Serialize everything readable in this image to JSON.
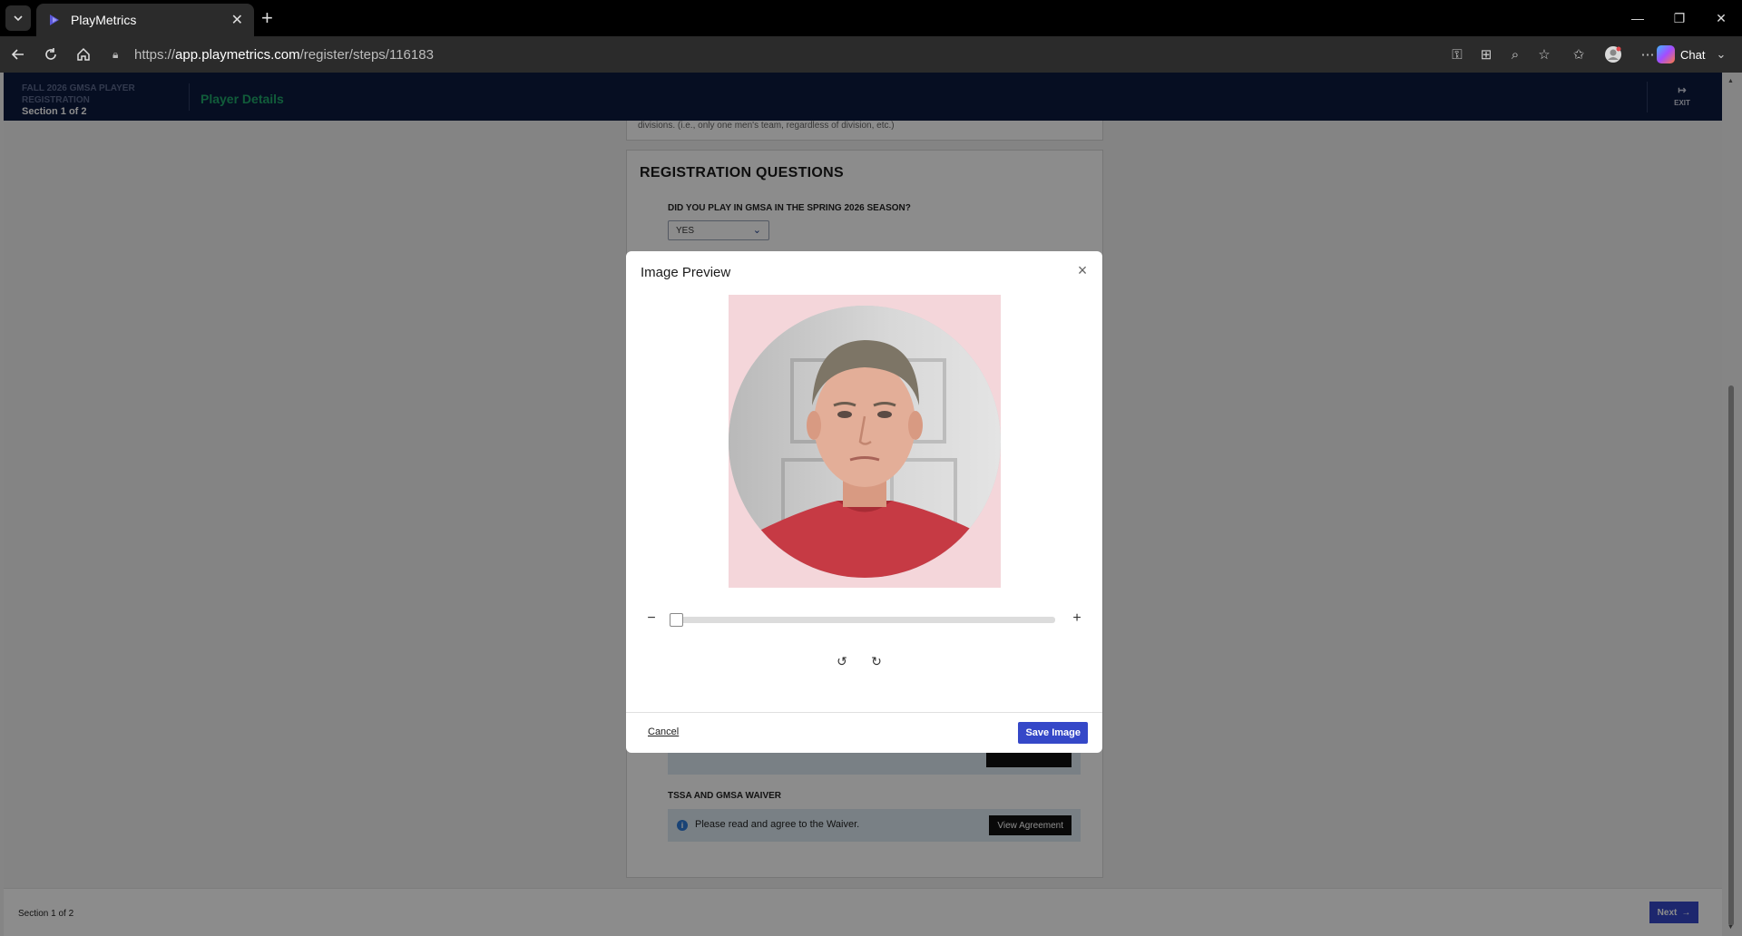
{
  "browser": {
    "tab_title": "PlayMetrics",
    "url_prefix": "https://",
    "url_host": "app.playmetrics.com",
    "url_path": "/register/steps/116183",
    "chat_label": "Chat",
    "icons": [
      "tab-list-icon",
      "close-icon",
      "plus-icon",
      "back-icon",
      "refresh-icon",
      "home-icon",
      "lock-icon",
      "key-icon",
      "apps-icon",
      "zoom-icon",
      "star-icon",
      "favorites-icon",
      "profile-icon",
      "more-icon",
      "chevron-down-icon"
    ]
  },
  "header": {
    "registration_name": "FALL 2026 GMSA PLAYER REGISTRATION",
    "section": "Section 1 of 2",
    "step": "Player Details",
    "exit_label": "EXIT",
    "colors": {
      "background": "#0c1a3f",
      "step": "#1fa86a"
    }
  },
  "page": {
    "top_card_text": "divisions. (i.e., only one men's team, regardless of division, etc.)",
    "heading": "REGISTRATION QUESTIONS",
    "question_label": "DID YOU PLAY IN GMSA IN THE SPRING 2026 SEASON?",
    "question_value": "YES",
    "waiver_label": "TSSA AND GMSA WAIVER",
    "waiver_text": "Please read and agree to the Waiver.",
    "view_agreement": "View Agreement"
  },
  "footer": {
    "section": "Section 1 of 2",
    "next_label": "Next"
  },
  "modal": {
    "title": "Image Preview",
    "zoom_level": 0,
    "cancel_label": "Cancel",
    "save_label": "Save Image",
    "colors": {
      "primary": "#3548c8"
    }
  }
}
